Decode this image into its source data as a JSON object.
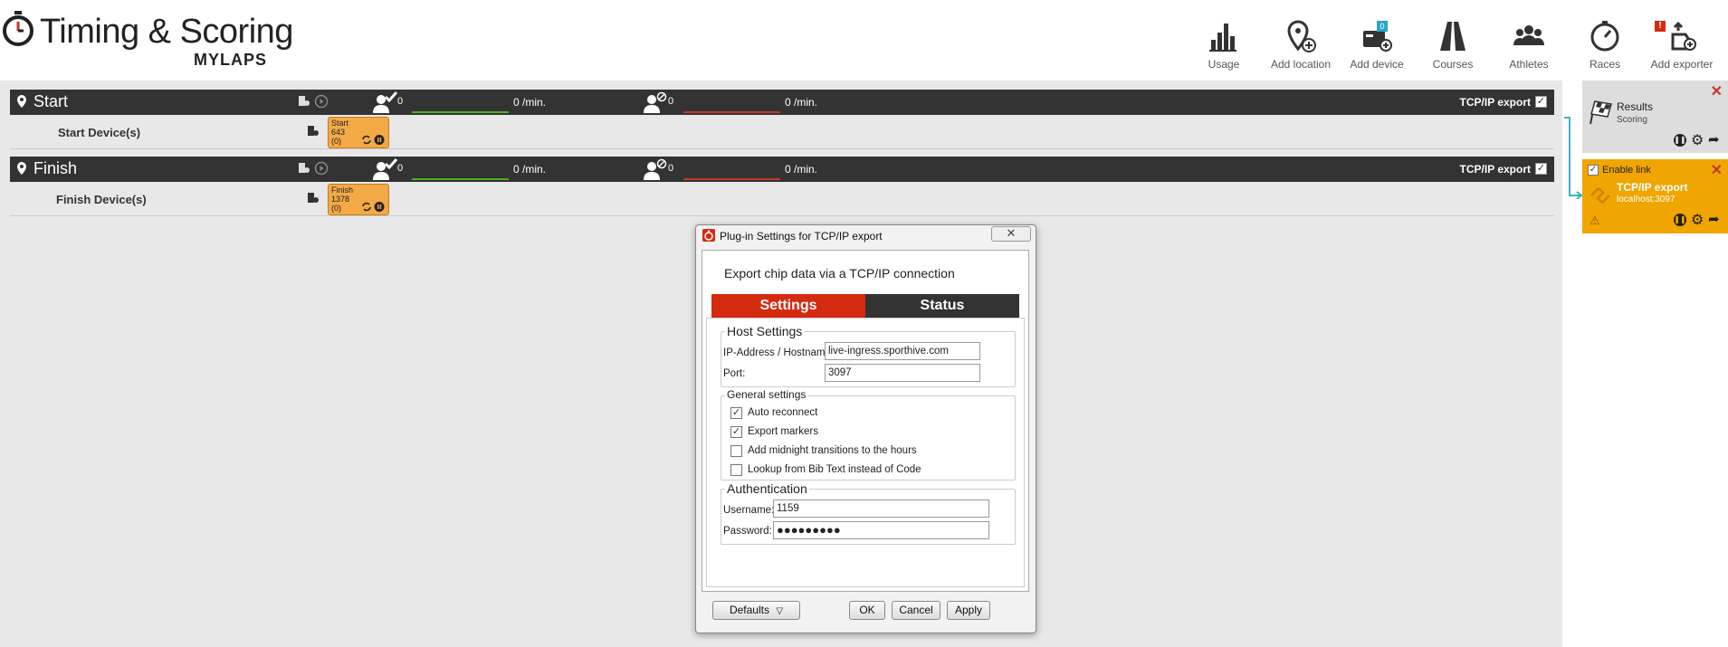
{
  "header": {
    "title": "Timing & Scoring",
    "brand": "MYLAPS",
    "toolbar": [
      {
        "label": "Usage",
        "icon": "bar-chart-icon"
      },
      {
        "label": "Add location",
        "icon": "location-pin-plus-icon"
      },
      {
        "label": "Add device",
        "icon": "device-plus-icon",
        "badge": "0"
      },
      {
        "label": "Courses",
        "icon": "road-icon"
      },
      {
        "label": "Athletes",
        "icon": "athletes-icon"
      },
      {
        "label": "Races",
        "icon": "stopwatch-icon"
      },
      {
        "label": "Add exporter",
        "icon": "exporter-icon",
        "badge": "!"
      }
    ]
  },
  "locations": [
    {
      "name": "Start",
      "passings": "0",
      "passings_rate": "0 /min.",
      "rejected": "0",
      "rejected_rate": "0 /min.",
      "tcp_label": "TCP/IP export",
      "tcp_checked": true,
      "device_row_label": "Start Device(s)",
      "chip": {
        "line1": "Start",
        "line2": "643",
        "line3": "(0)"
      }
    },
    {
      "name": "Finish",
      "passings": "0",
      "passings_rate": "0 /min.",
      "rejected": "0",
      "rejected_rate": "0 /min.",
      "tcp_label": "TCP/IP export",
      "tcp_checked": true,
      "device_row_label": "Finish Device(s)",
      "chip": {
        "line1": "Finish",
        "line2": "1378",
        "line3": "(0)"
      }
    }
  ],
  "right_panel": {
    "results_card": {
      "title": "Results",
      "subtitle": "Scoring"
    },
    "tcp_card": {
      "enable_label": "Enable link",
      "enabled": true,
      "title": "TCP/IP export",
      "subtitle": "localhost:3097"
    }
  },
  "dialog": {
    "title": "Plug-in Settings for TCP/IP export",
    "description": "Export chip data via a TCP/IP connection",
    "tabs": [
      "Settings",
      "Status"
    ],
    "active_tab": "Settings",
    "host_settings": {
      "legend": "Host Settings",
      "ip_label": "IP-Address / Hostname:",
      "ip_value": "live-ingress.sporthive.com",
      "port_label": "Port:",
      "port_value": "3097"
    },
    "general_settings": {
      "legend": "General settings",
      "options": [
        {
          "label": "Auto reconnect",
          "checked": true
        },
        {
          "label": "Export markers",
          "checked": true
        },
        {
          "label": "Add midnight transitions to the hours",
          "checked": false
        },
        {
          "label": "Lookup from Bib Text instead of Code",
          "checked": false
        }
      ]
    },
    "authentication": {
      "legend": "Authentication",
      "username_label": "Username:",
      "username_value": "1159",
      "password_label": "Password:",
      "password_value": "●●●●●●●●●"
    },
    "buttons": {
      "defaults": "Defaults",
      "ok": "OK",
      "cancel": "Cancel",
      "apply": "Apply"
    }
  },
  "colors": {
    "accent_red": "#d42a10",
    "dark_bar": "#333333",
    "chip_orange": "#f4a947",
    "link_orange": "#f0a500",
    "link_line": "#3bb0c9",
    "passings_green": "#4caf20",
    "rejected_red": "#c0392b"
  }
}
